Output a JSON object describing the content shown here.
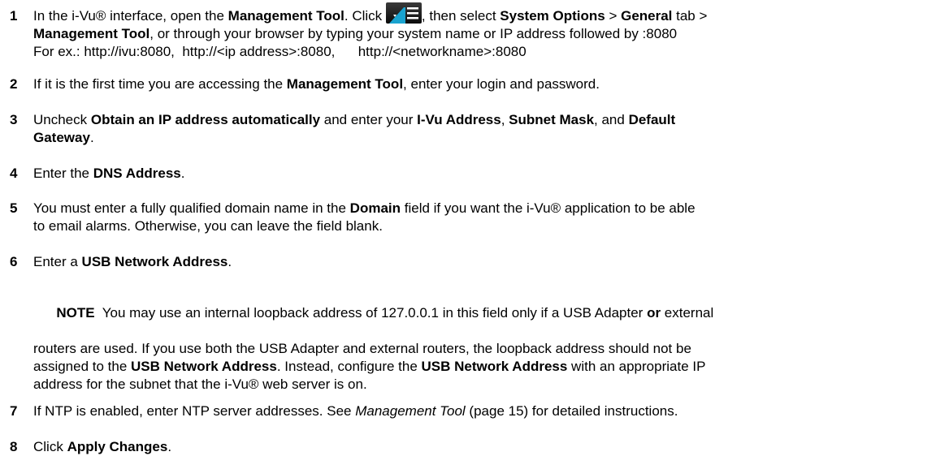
{
  "steps": [
    {
      "num": "1",
      "p1": "In the i-Vu® interface, open the ",
      "b1": "Management Tool",
      "p2": ". Click ",
      "icon": "menu-icon",
      "p3": ", then select ",
      "b2": "System Options",
      "p4": " > ",
      "b3": "General",
      "p5": " tab >",
      "b4": "Management Tool",
      "p6": ", or through your browser by typing your system name or IP address followed by :8080",
      "example": "For ex.: http://ivu:8080,  http://<ip address>:8080,      http://<networkname>:8080"
    },
    {
      "num": "2",
      "p1": "If it is the first time you are accessing the ",
      "b1": "Management Tool",
      "p2": ", enter your login and password."
    },
    {
      "num": "3",
      "p1": "Uncheck ",
      "b1": "Obtain an IP address automatically",
      "p2": " and enter your ",
      "b2": "I-Vu Address",
      "p3": ", ",
      "b3": "Subnet Mask",
      "p4": ", and ",
      "b4": "Default",
      "b5": "Gateway",
      "p5": "."
    },
    {
      "num": "4",
      "p1": "Enter the ",
      "b1": "DNS Address",
      "p2": "."
    },
    {
      "num": "5",
      "p1": "You must enter a fully qualified domain name in the ",
      "b1": "Domain",
      "p2": " field if you want the i-Vu® application to be able",
      "p3": "to email alarms. Otherwise, you can leave the field blank."
    },
    {
      "num": "6",
      "p1": "Enter a ",
      "b1": "USB Network Address",
      "p2": "."
    },
    {
      "num": "7",
      "p1": "If NTP is enabled, enter NTP server addresses. See ",
      "i1": "Management Tool",
      "p2": " (page 15) for detailed instructions."
    },
    {
      "num": "8",
      "p1": "Click ",
      "b1": "Apply Changes",
      "p2": "."
    }
  ],
  "note": {
    "label": "NOTE",
    "l1a": "  You may use an internal loopback address of 127.0.0.1 in this field only if a USB Adapter ",
    "l1b": "or",
    "l1c": " external",
    "l2": "routers are used. If you use both the USB Adapter and external routers, the loopback address should not be",
    "l3a": "assigned to the ",
    "l3b": "USB Network Address",
    "l3c": ". Instead, configure the ",
    "l3d": "USB Network Address",
    "l3e": " with an appropriate IP",
    "l4": "address for the subnet that the i-Vu® web server is on."
  }
}
